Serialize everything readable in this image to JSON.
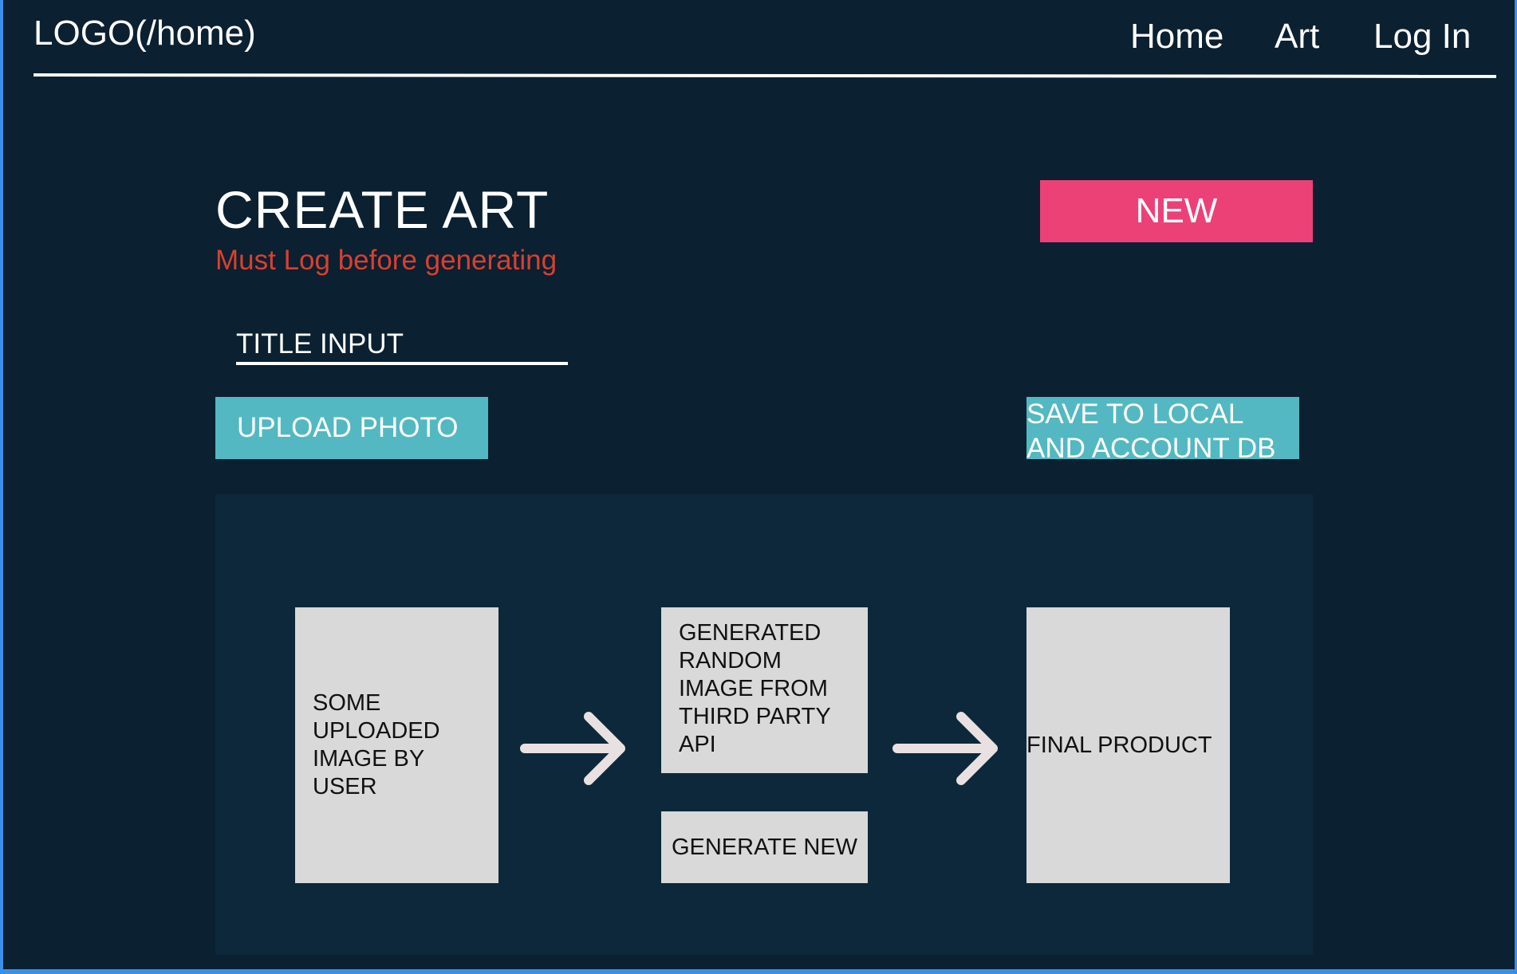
{
  "header": {
    "logo": "LOGO(/home)",
    "nav": {
      "home": "Home",
      "art": "Art",
      "login": "Log In"
    }
  },
  "main": {
    "title": "CREATE ART",
    "warning": "Must Log before generating",
    "new_button": "NEW",
    "title_input_placeholder": "TITLE INPUT",
    "upload_button": "UPLOAD PHOTO",
    "save_button_lines": [
      "SAVE TO LOCAL",
      "AND ACCOUNT DB"
    ]
  },
  "workspace": {
    "uploaded_lines": [
      "SOME",
      "UPLOADED",
      "IMAGE BY",
      "USER"
    ],
    "generated_lines": [
      "GENERATED",
      "RANDOM",
      "IMAGE FROM",
      "THIRD PARTY",
      "API"
    ],
    "generate_button": "GENERATE NEW",
    "final_product": "FINAL PRODUCT"
  },
  "colors": {
    "background": "#0b2030",
    "panel": "#0d283b",
    "accent_pink": "#ec4176",
    "accent_cyan": "#53b8c2",
    "warning_red": "#d8402f",
    "card_gray": "#d9d9d9",
    "frame_blue": "#3b8fe8"
  },
  "icons": {
    "flow_arrow": "arrow-right-icon"
  }
}
